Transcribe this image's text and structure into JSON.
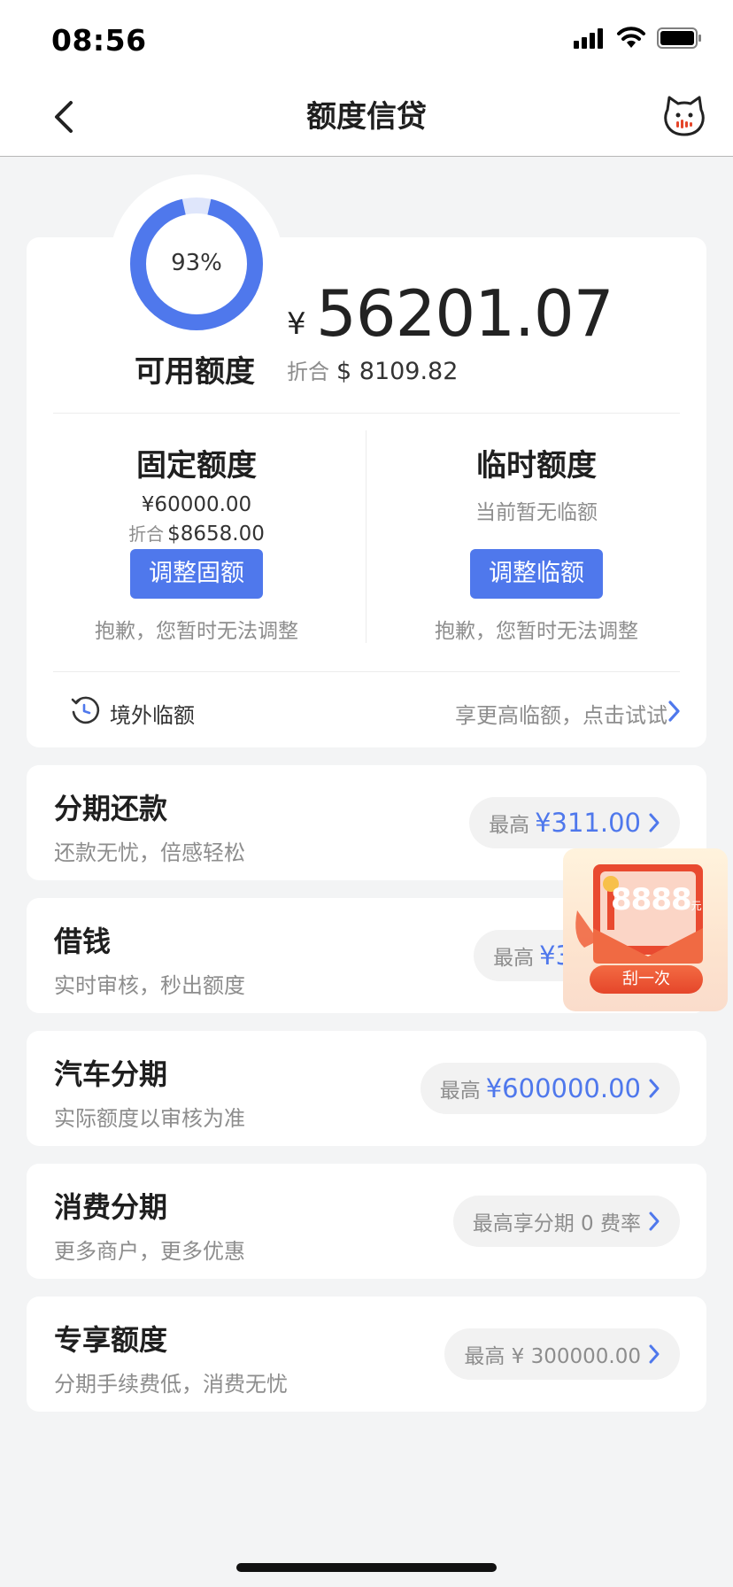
{
  "status_bar": {
    "time": "08:56"
  },
  "header": {
    "title": "额度信贷",
    "back_icon": "chevron-left-icon",
    "assistant_icon": "cat-assistant-icon"
  },
  "summary": {
    "usage_percent_label": "93%",
    "usage_fraction": 0.93,
    "available_label": "可用额度",
    "currency_symbol": "¥",
    "available_amount": "56201.07",
    "converted_label": "折合",
    "converted_amount": "$ 8109.82"
  },
  "fixed": {
    "title": "固定额度",
    "amount": "¥60000.00",
    "converted_label": "折合",
    "converted_amount": "$8658.00",
    "button": "调整固额",
    "note": "抱歉，您暂时无法调整"
  },
  "temporary": {
    "title": "临时额度",
    "status": "当前暂无临额",
    "button": "调整临额",
    "note": "抱歉，您暂时无法调整"
  },
  "overseas": {
    "label": "境外临额",
    "hint": "享更高临额，点击试试"
  },
  "rows": [
    {
      "title": "分期还款",
      "subtitle": "还款无忧，倍感轻松",
      "prefix": "最高",
      "amount": "¥311.00"
    },
    {
      "title": "借钱",
      "subtitle": "实时审核，秒出额度",
      "prefix": "最高",
      "amount": "¥3"
    },
    {
      "title": "汽车分期",
      "subtitle": "实际额度以审核为准",
      "prefix": "最高",
      "amount": "¥600000.00"
    },
    {
      "title": "消费分期",
      "subtitle": "更多商户，更多优惠",
      "text": "最高享分期 0 费率"
    },
    {
      "title": "专享额度",
      "subtitle": "分期手续费低，消费无忧",
      "text": "最高 ¥ 300000.00"
    }
  ],
  "promo": {
    "amount": "8888",
    "unit": "元",
    "button": "刮一次"
  },
  "colors": {
    "accent": "#4f78ec",
    "background": "#f3f4f5",
    "ring_track": "#dfe6fb"
  }
}
